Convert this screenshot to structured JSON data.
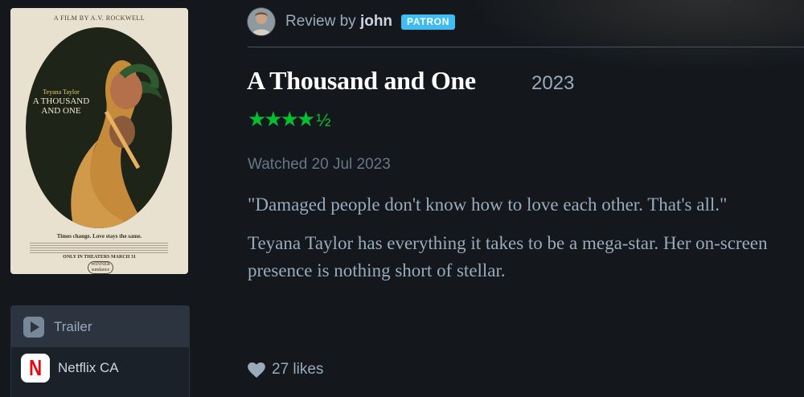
{
  "poster": {
    "credit": "A FILM BY A.V. ROCKWELL",
    "star_name": "Teyana Taylor",
    "title": "A THOUSAND AND ONE",
    "tagline": "Times change. Love stays the same.",
    "release": "ONLY IN THEATERS MARCH 31",
    "laurel": "WINNER sundance"
  },
  "watch": {
    "items": [
      {
        "label": "Trailer",
        "icon": "play-icon"
      },
      {
        "label": "Netflix CA",
        "icon": "netflix-logo-icon"
      }
    ]
  },
  "review": {
    "prefix": "Review by",
    "username": "john",
    "badge": "PATRON",
    "film_title": "A Thousand and One",
    "year": "2023",
    "rating_stars": "★★★★",
    "rating_half": "½",
    "rating_value": 4.5,
    "rating_max": 5,
    "watched": "Watched 20 Jul 2023",
    "paragraphs": [
      "\"Damaged people don't know how to love each other. That's all.\"",
      "Teyana Taylor has everything it takes to be a mega-star. Her on-screen presence is nothing short of stellar."
    ],
    "likes": "27 likes"
  },
  "colors": {
    "background": "#14181c",
    "star_green": "#00c030",
    "patron_blue": "#40bcf4",
    "text_muted": "#99aabb"
  }
}
